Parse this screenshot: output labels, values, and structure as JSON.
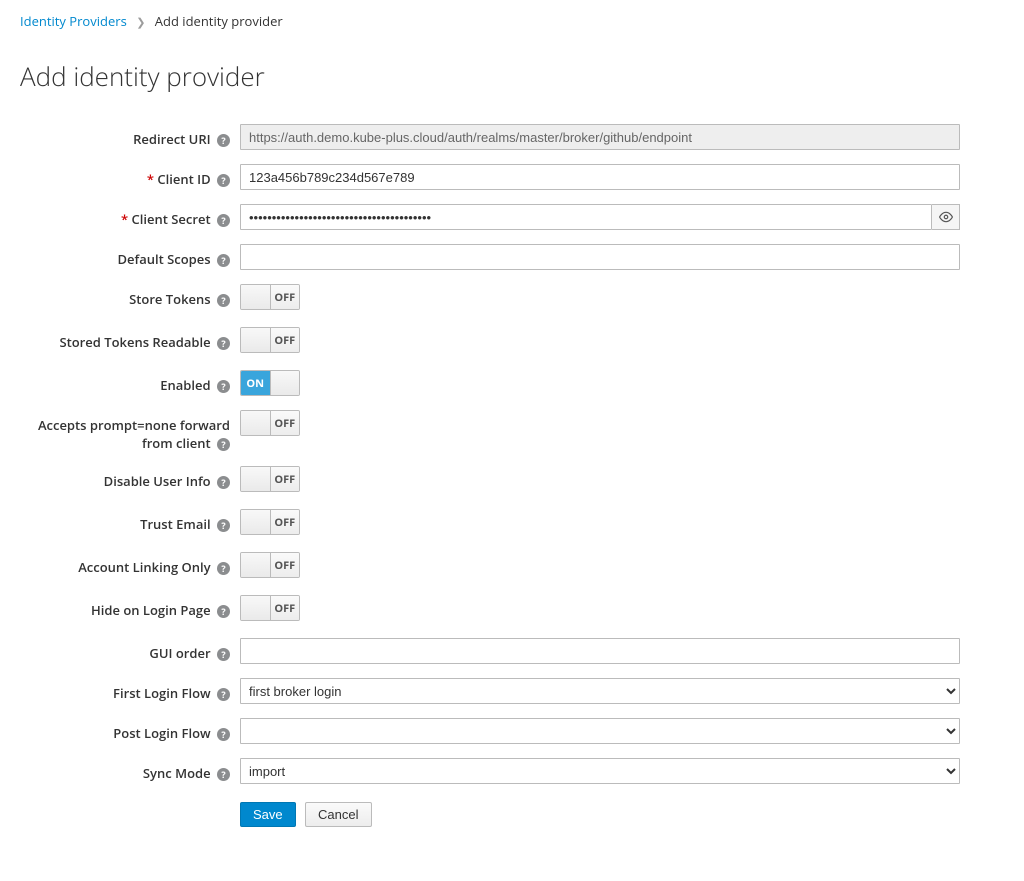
{
  "breadcrumb": {
    "link": "Identity Providers",
    "current": "Add identity provider"
  },
  "title": "Add identity provider",
  "labels": {
    "redirect_uri": "Redirect URI",
    "client_id": "Client ID",
    "client_secret": "Client Secret",
    "default_scopes": "Default Scopes",
    "store_tokens": "Store Tokens",
    "stored_tokens_readable": "Stored Tokens Readable",
    "enabled": "Enabled",
    "accepts_prompt": "Accepts prompt=none forward from client",
    "disable_user_info": "Disable User Info",
    "trust_email": "Trust Email",
    "account_linking_only": "Account Linking Only",
    "hide_on_login_page": "Hide on Login Page",
    "gui_order": "GUI order",
    "first_login_flow": "First Login Flow",
    "post_login_flow": "Post Login Flow",
    "sync_mode": "Sync Mode"
  },
  "values": {
    "redirect_uri": "https://auth.demo.kube-plus.cloud/auth/realms/master/broker/github/endpoint",
    "client_id": "123a456b789c234d567e789",
    "client_secret": "••••••••••••••••••••••••••••••••••••••••",
    "default_scopes": "",
    "gui_order": "",
    "first_login_flow": "first broker login",
    "post_login_flow": "",
    "sync_mode": "import"
  },
  "toggle": {
    "on": "ON",
    "off": "OFF"
  },
  "buttons": {
    "save": "Save",
    "cancel": "Cancel"
  },
  "select": {
    "first_login_flow_options": [
      "first broker login"
    ],
    "post_login_flow_options": [
      ""
    ],
    "sync_mode_options": [
      "import"
    ]
  }
}
